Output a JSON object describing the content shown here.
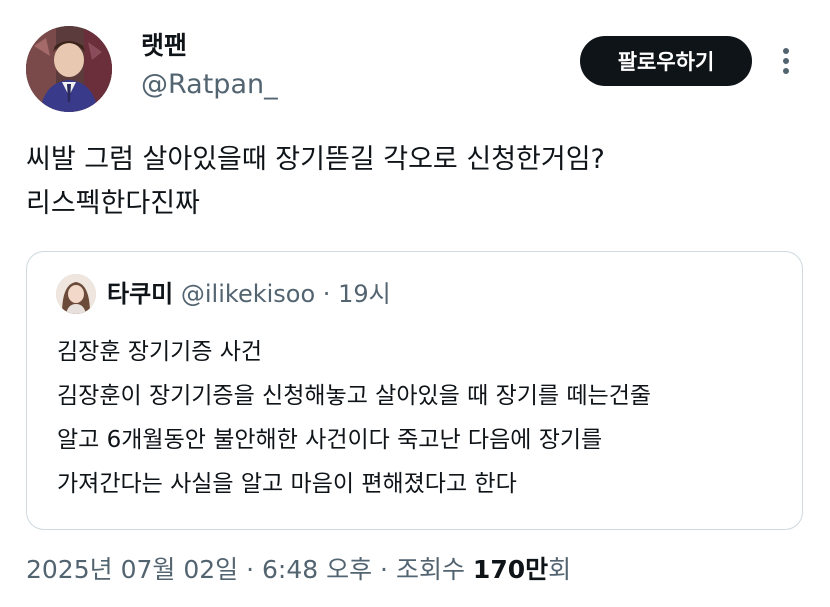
{
  "author": {
    "display_name": "랫팬",
    "handle": "@Ratpan_"
  },
  "actions": {
    "follow_label": "팔로우하기",
    "more_icon": "more-vertical-icon"
  },
  "tweet": {
    "lines": [
      "씨발 그럼 살아있을때 장기뜯길 각오로 신청한거임?",
      "리스펙한다진짜"
    ]
  },
  "quote": {
    "display_name": "타쿠미",
    "handle": "@ilikekisoo",
    "separator": "·",
    "time": "19시",
    "lines": [
      "김장훈 장기기증 사건",
      "김장훈이 장기기증을 신청해놓고 살아있을 때 장기를 떼는건줄",
      "알고 6개월동안 불안해한 사건이다 죽고난 다음에 장기를",
      "가져간다는 사실을 알고 마음이 편해졌다고 한다"
    ]
  },
  "meta": {
    "date": "2025년 07월 02일",
    "sep1": "·",
    "time": "6:48 오후",
    "sep2": "·",
    "views_label": "조회수",
    "views_number": "170만",
    "views_unit": "회"
  },
  "colors": {
    "text_primary": "#0f1419",
    "text_secondary": "#536471",
    "border": "#cfd9de",
    "follow_bg": "#0f1419"
  }
}
